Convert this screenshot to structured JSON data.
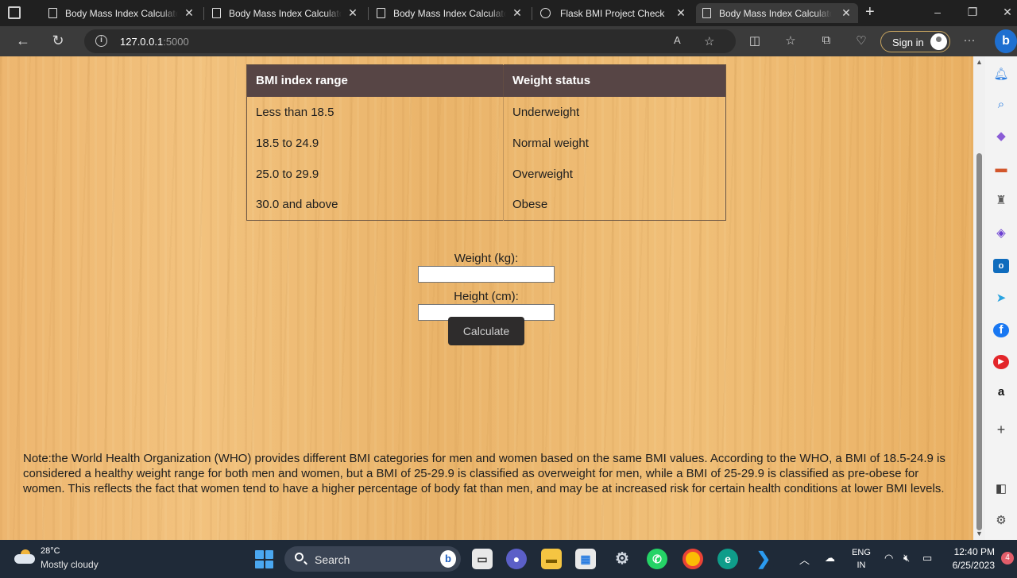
{
  "browser": {
    "tabs": [
      {
        "title": "Body Mass Index Calculator",
        "icon": "page-icon",
        "active": false
      },
      {
        "title": "Body Mass Index Calculator",
        "icon": "page-icon",
        "active": false
      },
      {
        "title": "Body Mass Index Calculator",
        "icon": "page-icon",
        "active": false
      },
      {
        "title": "Flask BMI Project Check",
        "icon": "globe-icon",
        "active": false
      },
      {
        "title": "Body Mass Index Calculator",
        "icon": "page-icon",
        "active": true
      }
    ],
    "close_glyph": "✕",
    "new_tab_glyph": "+",
    "url_host": "127.0.0.1",
    "url_port": ":5000",
    "sign_in_label": "Sign in",
    "more_glyph": "···",
    "bing_glyph": "b"
  },
  "page": {
    "table": {
      "headers": [
        "BMI index range",
        "Weight status"
      ],
      "rows": [
        [
          "Less than 18.5",
          "Underweight"
        ],
        [
          "18.5 to 24.9",
          "Normal weight"
        ],
        [
          "25.0 to 29.9",
          "Overweight"
        ],
        [
          "30.0 and above",
          "Obese"
        ]
      ]
    },
    "form": {
      "weight_label": "Weight (kg):",
      "height_label": "Height (cm):",
      "weight_value": "",
      "height_value": "",
      "calculate_label": "Calculate"
    },
    "note": "Note:the World Health Organization (WHO) provides different BMI categories for men and women based on the same BMI values. According to the WHO, a BMI of 18.5-24.9 is considered a healthy weight range for both men and women, but a BMI of 25-29.9 is classified as overweight for men, while a BMI of 25-29.9 is classified as pre-obese for women. This reflects the fact that women tend to have a higher percentage of body fat than men, and may be at increased risk for certain health conditions at lower BMI levels."
  },
  "taskbar": {
    "temperature": "28°C",
    "condition": "Mostly cloudy",
    "search_label": "Search",
    "lang_line1": "ENG",
    "lang_line2": "IN",
    "time": "12:40 PM",
    "date": "6/25/2023",
    "notification_count": "4"
  },
  "colors": {
    "table_header": "#574545",
    "button_bg": "#2e2c2c",
    "accent": "#1e6fd0"
  }
}
